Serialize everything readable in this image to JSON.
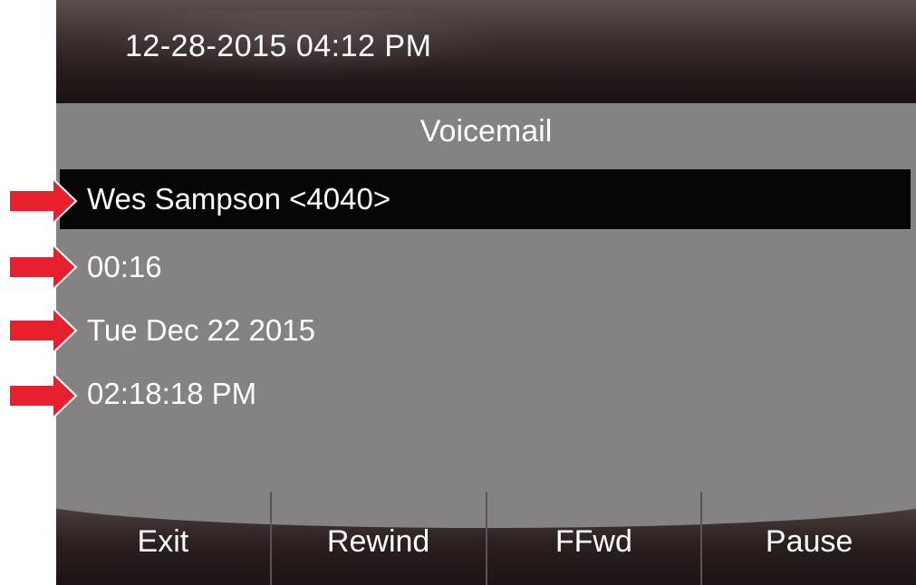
{
  "status_bar": {
    "datetime": "12-28-2015 04:12 PM"
  },
  "screen": {
    "title": "Voicemail",
    "details": [
      {
        "label": "Wes Sampson <4040>",
        "selected": true
      },
      {
        "label": "00:16",
        "selected": false
      },
      {
        "label": "Tue Dec 22 2015",
        "selected": false
      },
      {
        "label": "02:18:18 PM",
        "selected": false
      }
    ]
  },
  "softkeys": {
    "exit": "Exit",
    "rewind": "Rewind",
    "ffwd": "FFwd",
    "pause": "Pause"
  },
  "colors": {
    "screen_background": "#858283",
    "selected_row": "#050505",
    "annotation_arrow": "#e8202e",
    "text": "#ffffff"
  }
}
